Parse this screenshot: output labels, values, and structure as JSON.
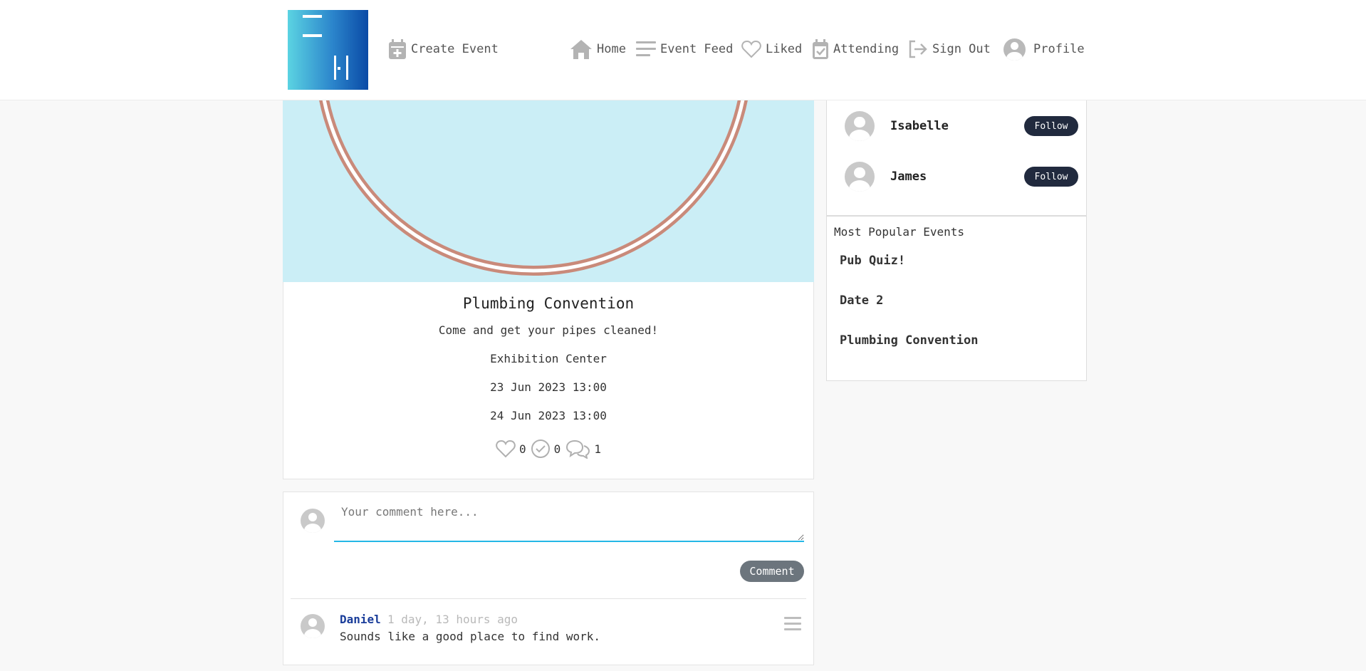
{
  "nav": {
    "create_event": "Create Event",
    "home": "Home",
    "event_feed": "Event Feed",
    "liked": "Liked",
    "attending": "Attending",
    "sign_out": "Sign Out",
    "profile": "Profile"
  },
  "event": {
    "title": "Plumbing Convention",
    "description": "Come and get your pipes cleaned!",
    "location": "Exhibition Center",
    "start": "23 Jun 2023 13:00",
    "end": "24 Jun 2023 13:00",
    "likes": "0",
    "attending": "0",
    "comments": "1"
  },
  "comment_form": {
    "placeholder": "Your comment here...",
    "button": "Comment",
    "accent": "#25b7e6"
  },
  "comments": [
    {
      "author": "Daniel",
      "time": "1 day, 13 hours ago",
      "text": "Sounds like a good place to find work."
    }
  ],
  "suggested_follows": [
    {
      "name": "Isabelle",
      "button": "Follow"
    },
    {
      "name": "James",
      "button": "Follow"
    }
  ],
  "popular": {
    "title": "Most Popular Events",
    "items": [
      "Pub Quiz!",
      "Date 2",
      "Plumbing Convention"
    ]
  },
  "colors": {
    "hero_bg": "#cbeef6",
    "follow_btn": "#212a3e",
    "comment_btn": "#6c757d",
    "author_link": "#1a3d9a"
  }
}
